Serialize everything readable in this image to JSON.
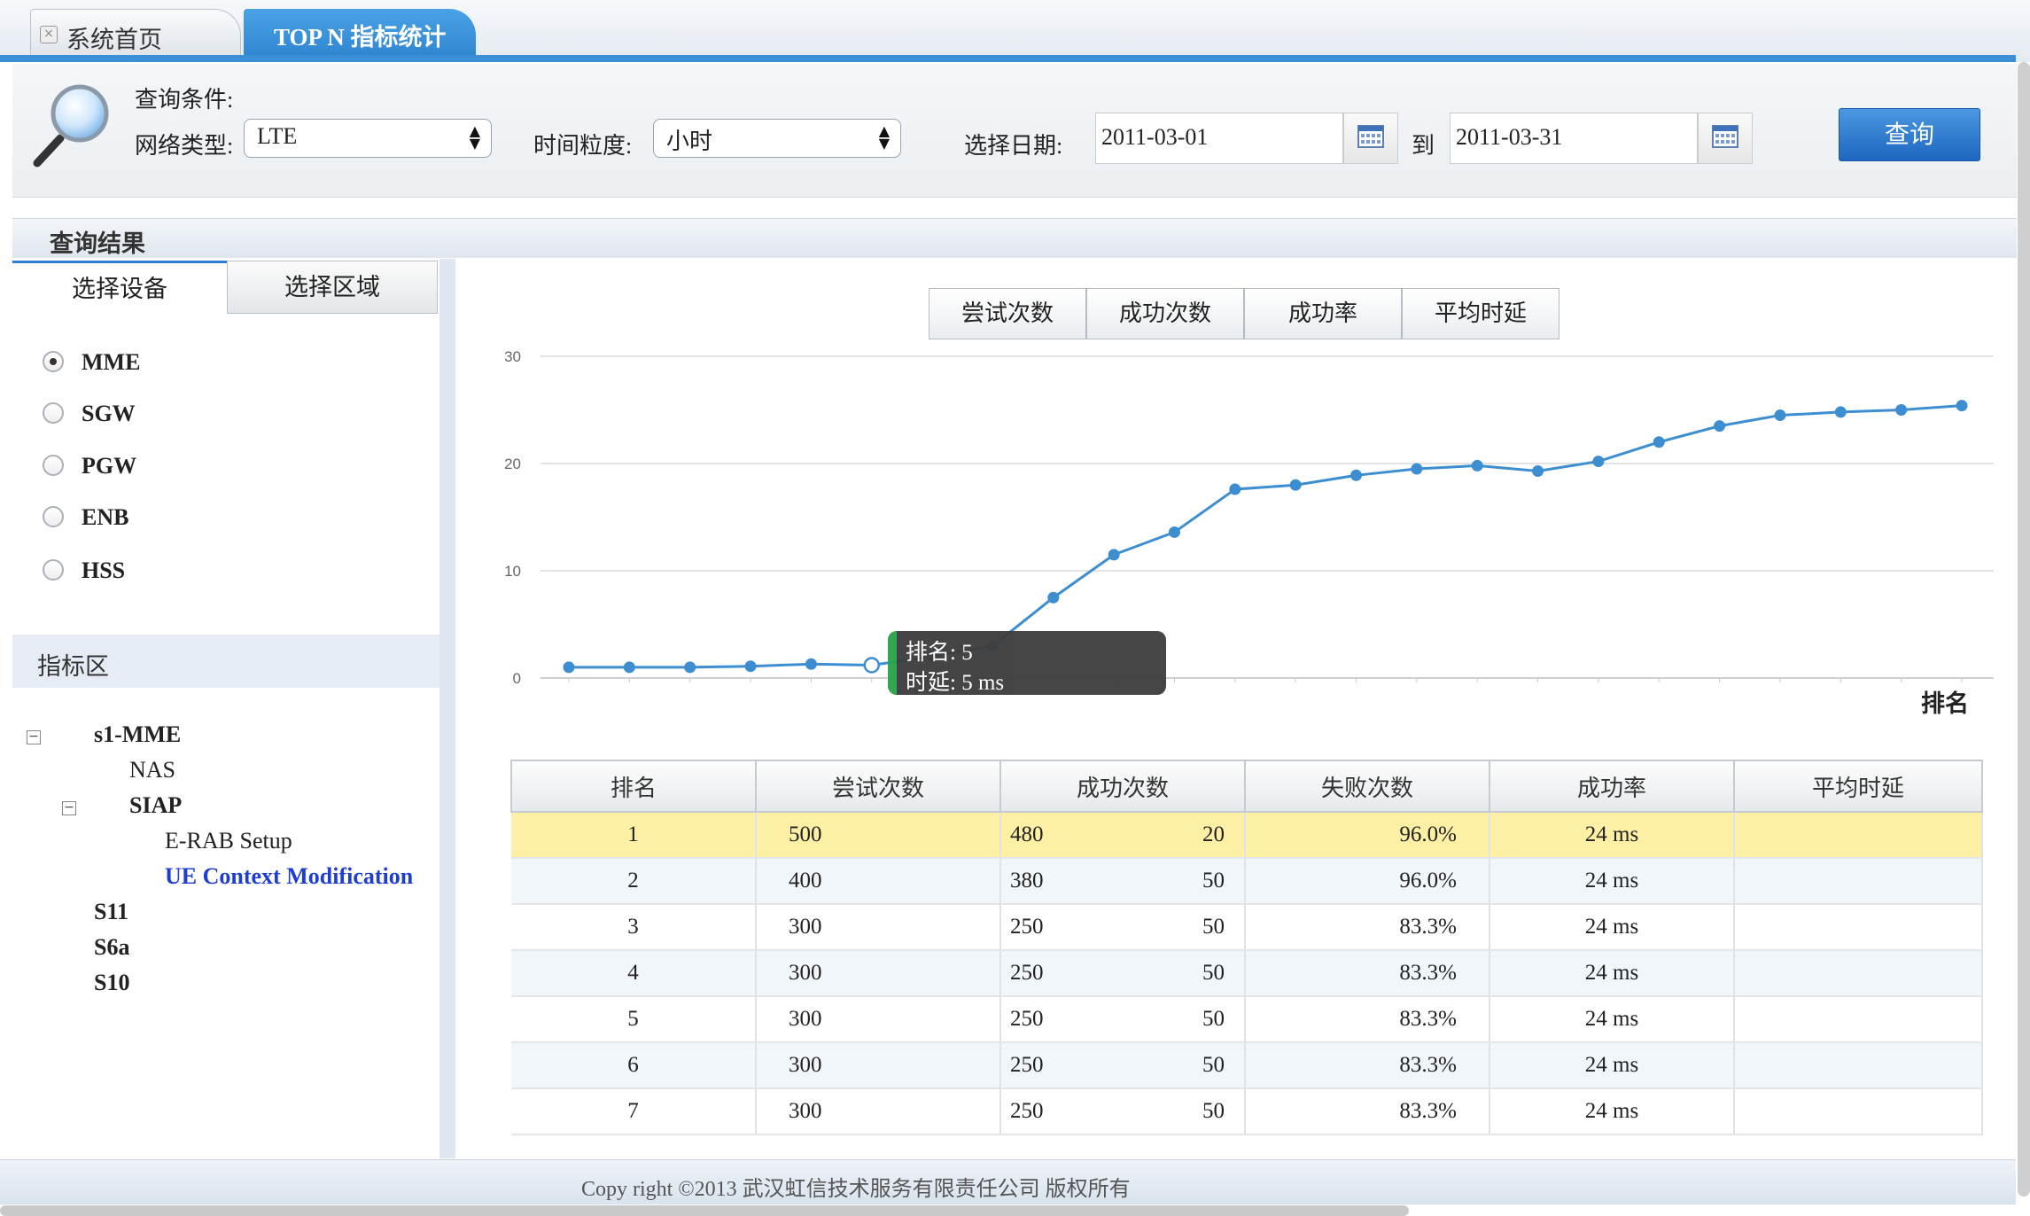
{
  "tabs": [
    {
      "label": "系统首页",
      "active": false
    },
    {
      "label": "TOP N 指标统计",
      "active": true
    }
  ],
  "query": {
    "title": "查询条件:",
    "network_type_label": "网络类型:",
    "network_type_value": "LTE",
    "granularity_label": "时间粒度:",
    "granularity_value": "小时",
    "date_label": "选择日期:",
    "date_from": "2011-03-01",
    "date_to_label": "到",
    "date_to": "2011-03-31",
    "submit_label": "查询"
  },
  "results": {
    "header": "查询结果",
    "left_tabs": [
      "选择设备",
      "选择区域"
    ],
    "devices": [
      {
        "label": "MME",
        "selected": true
      },
      {
        "label": "SGW",
        "selected": false
      },
      {
        "label": "PGW",
        "selected": false
      },
      {
        "label": "ENB",
        "selected": false
      },
      {
        "label": "HSS",
        "selected": false
      }
    ],
    "indicator_header": "指标区",
    "tree": {
      "root": "s1-MME",
      "nas": "NAS",
      "siap": "SIAP",
      "erab": "E-RAB  Setup",
      "ue_ctx": "UE Context Modification",
      "s11": "S11",
      "s6a": "S6a",
      "s10": "S10"
    },
    "metric_tabs": [
      "尝试次数",
      "成功次数",
      "成功率",
      "平均时延"
    ]
  },
  "chart_data": {
    "type": "line",
    "x": [
      1,
      2,
      3,
      4,
      5,
      6,
      7,
      8,
      9,
      10,
      11,
      12,
      13,
      14,
      15,
      16,
      17,
      18,
      19,
      20,
      21,
      22,
      23,
      24
    ],
    "values": [
      1.0,
      1.0,
      1.0,
      1.1,
      1.3,
      1.2,
      2.0,
      3.0,
      7.5,
      11.5,
      13.6,
      17.6,
      18.0,
      18.9,
      19.5,
      19.8,
      19.3,
      20.2,
      22.0,
      23.5,
      24.5,
      24.8,
      25.0,
      25.4
    ],
    "xlabel": "排名",
    "ylim": [
      0,
      30
    ],
    "yticks": [
      0,
      10,
      20,
      30
    ],
    "grid": true,
    "color": "#3d8ed1",
    "highlight_index": 5,
    "tooltip": {
      "line1": "排名:  5",
      "line2": "时延:  5 ms"
    }
  },
  "table": {
    "headers": [
      "排名",
      "尝试次数",
      "成功次数",
      "失败次数",
      "成功率",
      "平均时延"
    ],
    "rows": [
      [
        "1",
        "500",
        "480",
        "20",
        "96.0%",
        "24 ms",
        ""
      ],
      [
        "2",
        "400",
        "380",
        "50",
        "96.0%",
        "24 ms",
        ""
      ],
      [
        "3",
        "300",
        "250",
        "50",
        "83.3%",
        "24 ms",
        ""
      ],
      [
        "4",
        "300",
        "250",
        "50",
        "83.3%",
        "24 ms",
        ""
      ],
      [
        "5",
        "300",
        "250",
        "50",
        "83.3%",
        "24 ms",
        ""
      ],
      [
        "6",
        "300",
        "250",
        "50",
        "83.3%",
        "24 ms",
        ""
      ],
      [
        "7",
        "300",
        "250",
        "50",
        "83.3%",
        "24 ms",
        ""
      ]
    ],
    "highlight_row": 0
  },
  "footer": "Copy right ©2013  武汉虹信技术服务有限责任公司    版权所有"
}
